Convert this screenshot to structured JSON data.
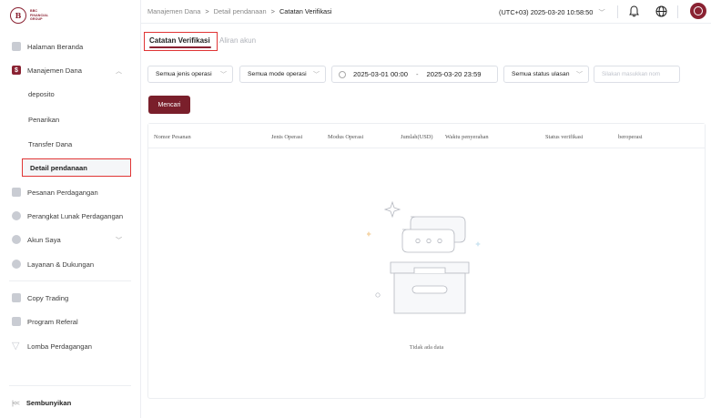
{
  "brand": {
    "logo_letter": "B",
    "logo_text_1": "BBC",
    "logo_text_2": "FINANCIAL",
    "logo_text_3": "GROUP",
    "accent": "#8a2232",
    "highlight": "#e03535"
  },
  "sidebar": {
    "items": [
      {
        "label": "Halaman Beranda"
      },
      {
        "label": "Manajemen Dana"
      },
      {
        "label": "deposito"
      },
      {
        "label": "Penarikan"
      },
      {
        "label": "Transfer Dana"
      },
      {
        "label": "Detail pendanaan"
      },
      {
        "label": "Pesanan Perdagangan"
      },
      {
        "label": "Perangkat Lunak Perdagangan"
      },
      {
        "label": "Akun Saya"
      },
      {
        "label": "Layanan & Dukungan"
      },
      {
        "label": "Copy Trading"
      },
      {
        "label": "Program Referal"
      },
      {
        "label": "Lomba Perdagangan"
      }
    ],
    "collapse_label": "Sembunyikan",
    "collapse_icon": "|<<"
  },
  "header": {
    "breadcrumb": [
      "Manajemen Dana",
      "Detail pendanaan",
      "Catatan Verifikasi"
    ],
    "timezone": "(UTC+03) 2025-03-20 10:58:50"
  },
  "tabs": [
    {
      "label": "Catatan Verifikasi"
    },
    {
      "label": "Aliran akun"
    }
  ],
  "filters": {
    "operation_type": "Semua jenis operasi",
    "operation_mode": "Semua mode operasi",
    "date_start": "2025-03-01 00:00",
    "date_sep": "-",
    "date_end": "2025-03-20 23:59",
    "review_status": "Semua status ulasan",
    "search_placeholder": "Silakan masukkan nom",
    "search_button": "Mencari"
  },
  "table": {
    "columns": [
      "Nomor Pesanan",
      "Jenis Operasi",
      "Modus Operasi",
      "Jumlah(USD)",
      "Waktu penyerahan",
      "Status verifikasi",
      "beroperasi"
    ],
    "rows": [],
    "empty_text": "Tidak ada data"
  }
}
